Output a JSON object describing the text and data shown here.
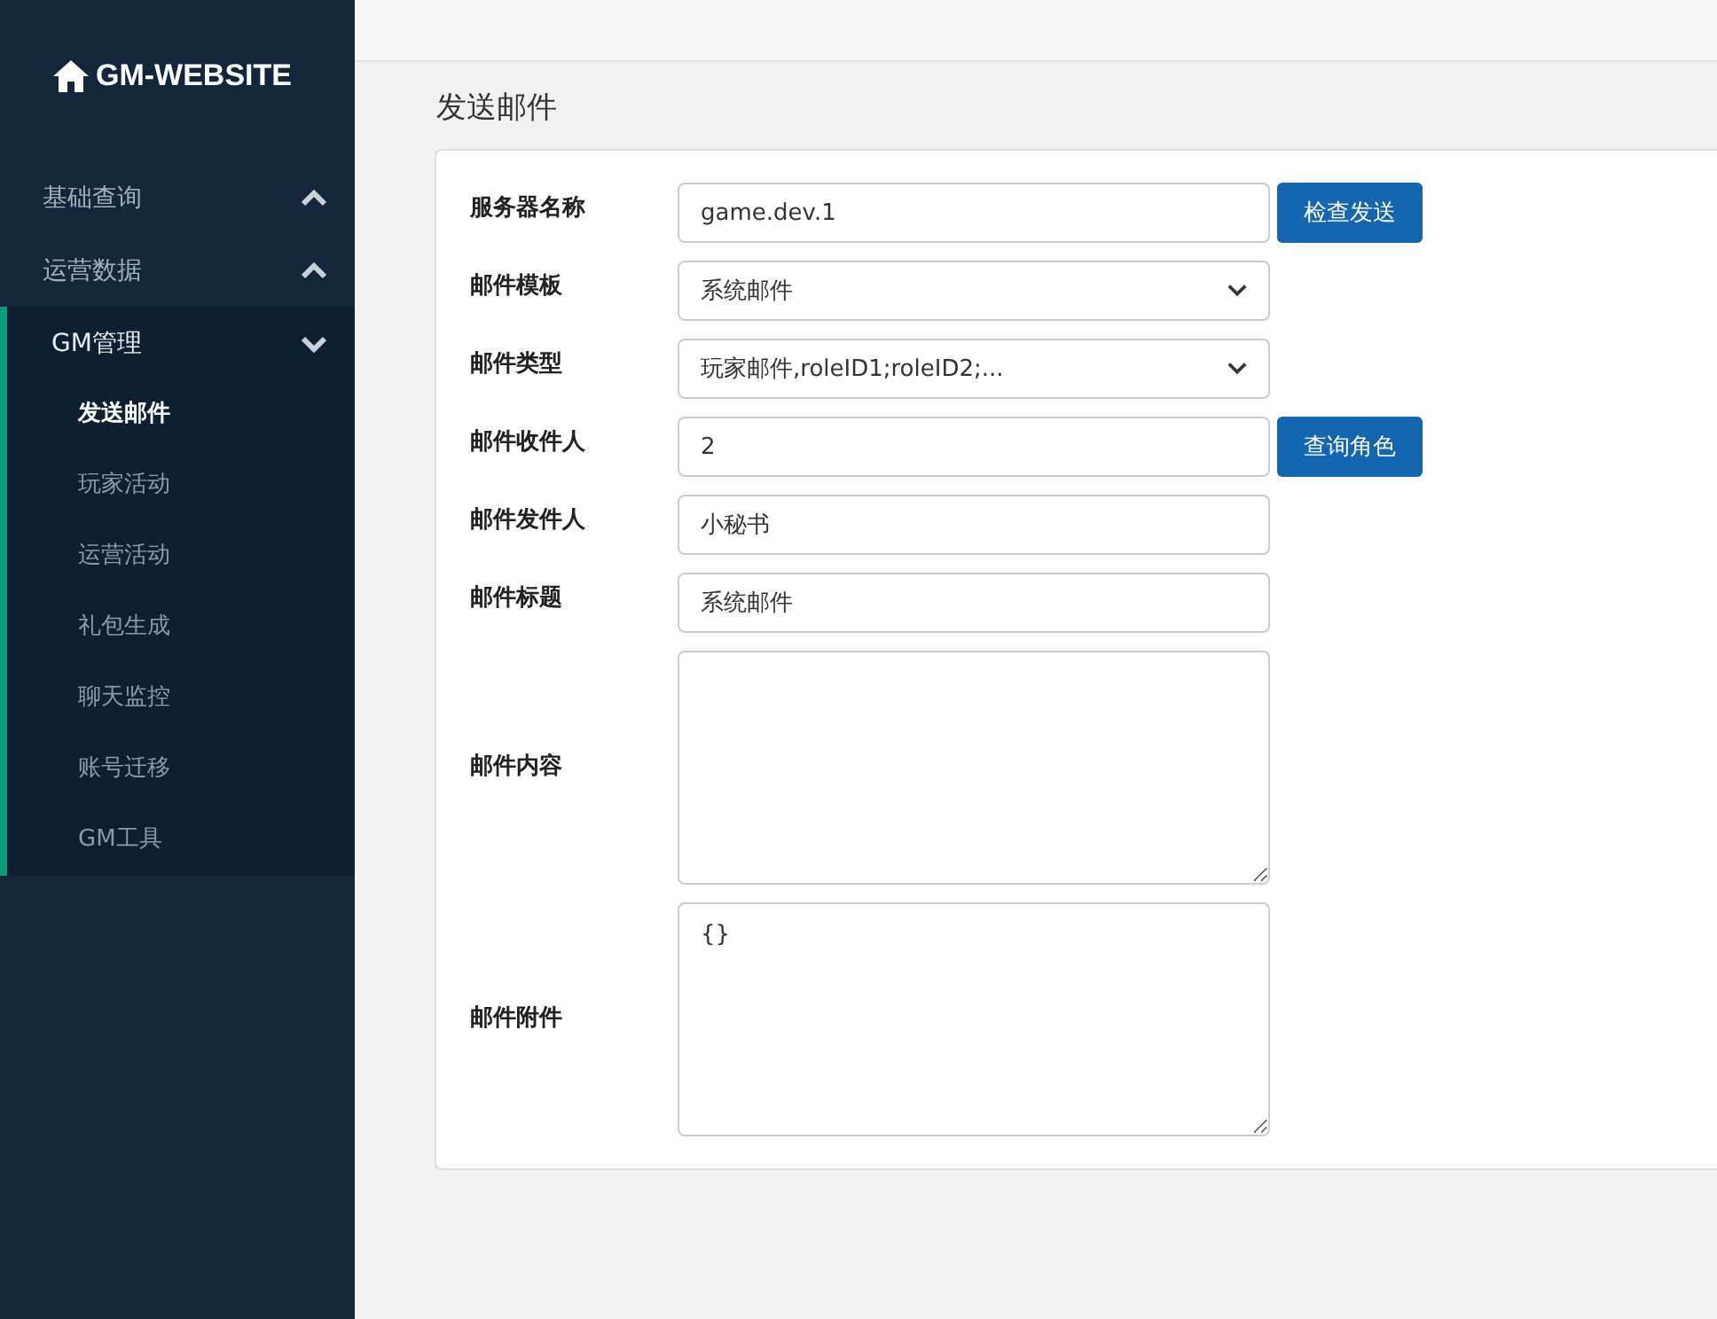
{
  "sidebar": {
    "logo": "GM-WEBSITE",
    "menu": [
      {
        "label": "基础查询",
        "expanded": false
      },
      {
        "label": "运营数据",
        "expanded": false
      },
      {
        "label": "GM管理",
        "expanded": true,
        "children": [
          {
            "label": "发送邮件",
            "selected": true
          },
          {
            "label": "玩家活动",
            "selected": false
          },
          {
            "label": "运营活动",
            "selected": false
          },
          {
            "label": "礼包生成",
            "selected": false
          },
          {
            "label": "聊天监控",
            "selected": false
          },
          {
            "label": "账号迁移",
            "selected": false
          },
          {
            "label": "GM工具",
            "selected": false
          }
        ]
      }
    ]
  },
  "page_title": "发送邮件",
  "form": {
    "fields": [
      {
        "label": "服务器名称",
        "kind": "input",
        "value": "game.dev.1",
        "button": "检查发送"
      },
      {
        "label": "邮件模板",
        "kind": "select",
        "value": "系统邮件"
      },
      {
        "label": "邮件类型",
        "kind": "select",
        "value": "玩家邮件,roleID1;roleID2;..."
      },
      {
        "label": "邮件收件人",
        "kind": "input",
        "value": "2",
        "button": "查询角色"
      },
      {
        "label": "邮件发件人",
        "kind": "input",
        "value": "小秘书"
      },
      {
        "label": "邮件标题",
        "kind": "input",
        "value": "系统邮件"
      },
      {
        "label": "邮件内容",
        "kind": "textarea"
      },
      {
        "label": "邮件附件",
        "kind": "textarea",
        "value": "{}"
      }
    ]
  }
}
